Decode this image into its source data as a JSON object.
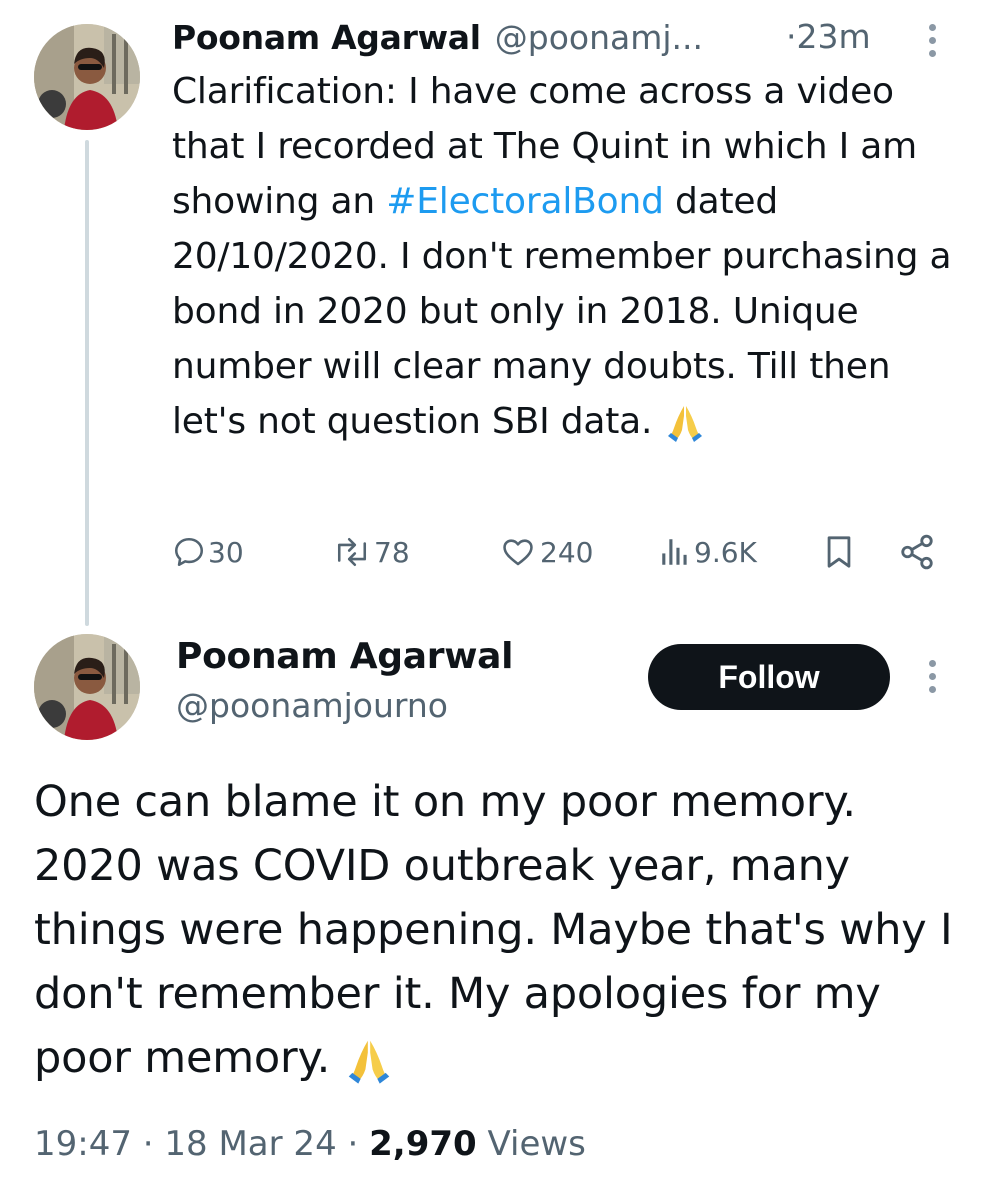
{
  "tweet1": {
    "author_name": "Poonam Agarwal",
    "handle": "@poonamj...",
    "dot": "·",
    "time": "23m",
    "text_before_tag": "Clarification: I have come across a video that I recorded at The Quint in which I am showing an ",
    "hashtag": "#ElectoralBond",
    "text_after_tag": " dated 20/10/2020. I don't remember purchasing a bond in 2020 but only in 2018. Unique number will clear many doubts. Till then let's not question SBI data.",
    "emoji_icon": "folded-hands-icon",
    "actions": {
      "replies": "30",
      "reposts": "78",
      "likes": "240",
      "views": "9.6K"
    }
  },
  "tweet2": {
    "author_name": "Poonam Agarwal",
    "handle": "@poonamjourno",
    "follow_label": "Follow",
    "text": "One can blame it on my poor memory. 2020 was COVID outbreak year, many things were happening. Maybe that's why I don't remember it. My apologies for my poor memory.",
    "emoji_icon": "folded-hands-icon",
    "timestamp": "19:47 · 18 Mar 24 ·",
    "views_count": "2,970",
    "views_label": "Views"
  },
  "colors": {
    "text": "#0f1419",
    "secondary": "#536471",
    "link": "#1d9bf0",
    "thread_line": "#cfd9de",
    "follow_bg": "#0f1419"
  }
}
